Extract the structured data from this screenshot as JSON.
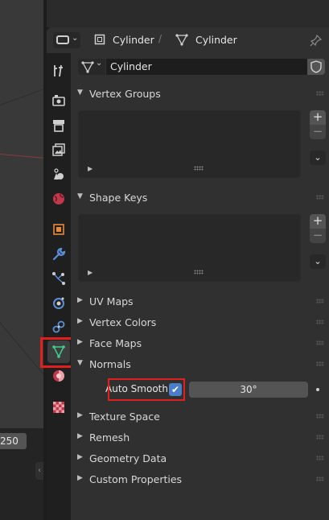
{
  "header": {
    "object_name": "Cylinder",
    "mesh_name": "Cylinder"
  },
  "viewport": {
    "frame_value": "250"
  },
  "datablock": {
    "name": "Cylinder"
  },
  "sections": {
    "vertex_groups": "Vertex Groups",
    "shape_keys": "Shape Keys",
    "uv_maps": "UV Maps",
    "vertex_colors": "Vertex Colors",
    "face_maps": "Face Maps",
    "normals": "Normals",
    "texture_space": "Texture Space",
    "remesh": "Remesh",
    "geometry_data": "Geometry Data",
    "custom_properties": "Custom Properties"
  },
  "normals": {
    "auto_smooth_label": "Auto Smooth",
    "auto_smooth_checked": true,
    "angle_value": "30°"
  },
  "tabs": [
    "tool-icon",
    "render-icon",
    "output-icon",
    "view-layer-icon",
    "scene-icon",
    "world-icon",
    "object-icon",
    "modifier-icon",
    "particles-icon",
    "physics-icon",
    "constraints-icon",
    "data-icon",
    "material-icon",
    "texture-icon"
  ],
  "colors": {
    "highlight": "#e0201c",
    "checkbox": "#4a7fc8",
    "data_tab_active": "#3d3d3d"
  }
}
